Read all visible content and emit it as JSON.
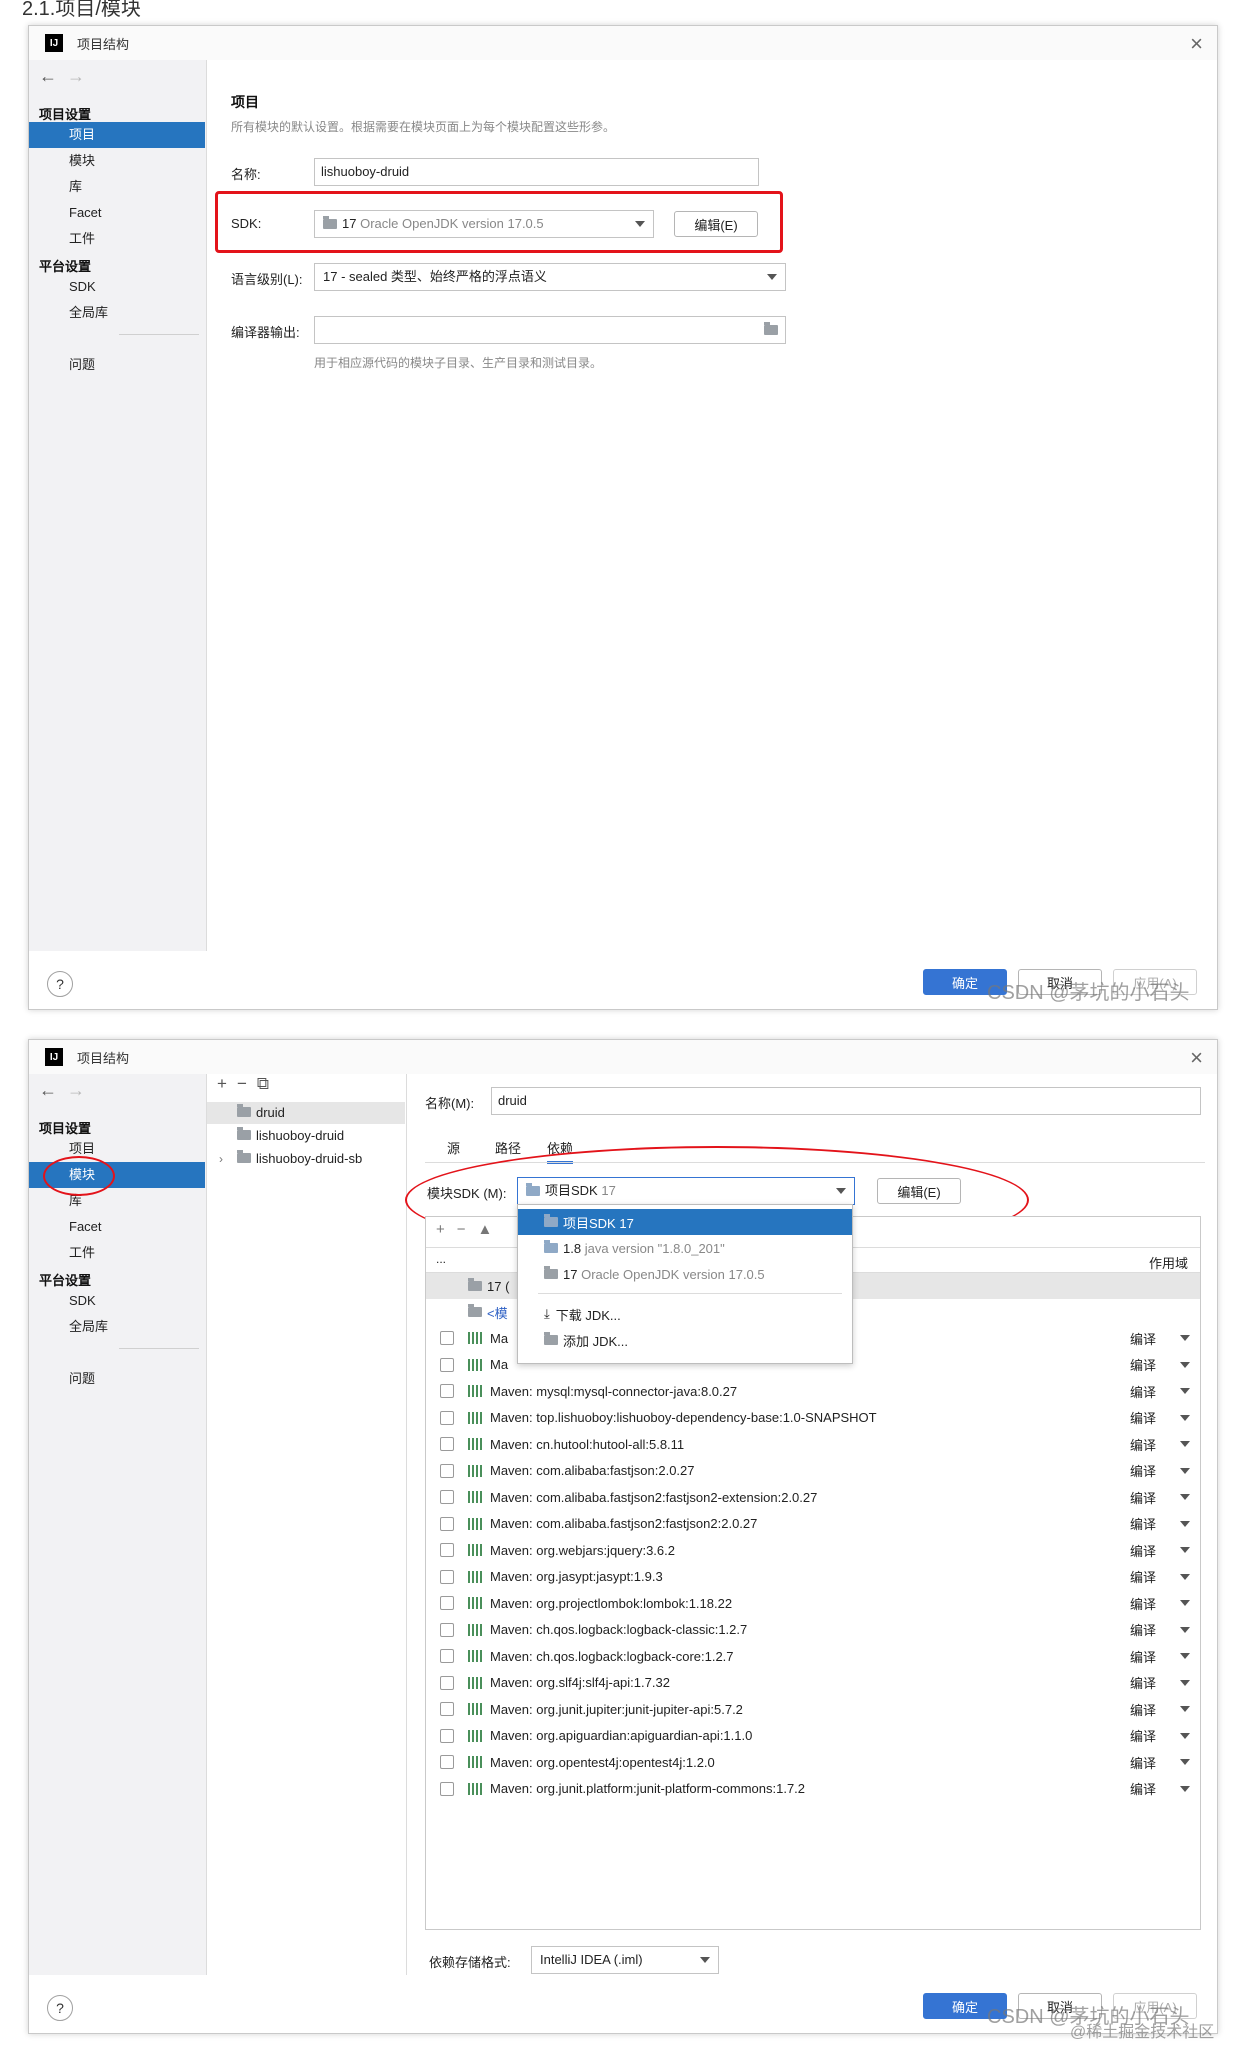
{
  "page_heading": "2.1.项目/模块",
  "watermark": "CSDN @茅坑的小石头",
  "site_watermark": "@稀土掘金技术社区",
  "dialog1": {
    "title": "项目结构",
    "sidebar": {
      "group_project": "项目设置",
      "items_project": [
        "项目",
        "模块",
        "库",
        "Facet",
        "工件"
      ],
      "group_platform": "平台设置",
      "items_platform": [
        "SDK",
        "全局库"
      ],
      "problems": "问题"
    },
    "section_title": "项目",
    "section_desc": "所有模块的默认设置。根据需要在模块页面上为每个模块配置这些形参。",
    "name_label": "名称:",
    "name_value": "lishuoboy-druid",
    "sdk_label": "SDK:",
    "sdk_value_num": "17",
    "sdk_value_desc": "Oracle OpenJDK version 17.0.5",
    "sdk_edit_button": "编辑(E)",
    "lang_label": "语言级别(L):",
    "lang_value": "17 - sealed 类型、始终严格的浮点语义",
    "compiler_label": "编译器输出:",
    "compiler_value": "",
    "compiler_hint": "用于相应源代码的模块子目录、生产目录和测试目录。",
    "ok_button": "确定",
    "cancel_button": "取消",
    "apply_button": "应用(A)",
    "help": "?"
  },
  "dialog2": {
    "title": "项目结构",
    "sidebar": {
      "group_project": "项目设置",
      "items_project": [
        "项目",
        "模块",
        "库",
        "Facet",
        "工件"
      ],
      "group_platform": "平台设置",
      "items_platform": [
        "SDK",
        "全局库"
      ],
      "problems": "问题"
    },
    "tree": [
      "druid",
      "lishuoboy-druid",
      "lishuoboy-druid-sb"
    ],
    "name_label": "名称(M):",
    "name_value": "druid",
    "tabs": [
      "源",
      "路径",
      "依赖"
    ],
    "module_sdk_label": "模块SDK (M):",
    "module_sdk_value": "项目SDK",
    "module_sdk_version": "17",
    "module_sdk_edit": "编辑(E)",
    "deps_header_col": "...",
    "deps_scope_header": "作用域",
    "dropdown": {
      "item1": "项目SDK 17",
      "item2_num": "1.8",
      "item2_desc": "java version \"1.8.0_201\"",
      "item3_num": "17",
      "item3_desc": "Oracle OpenJDK version 17.0.5",
      "download": "下载 JDK...",
      "add": "添加 JDK..."
    },
    "deps_sdk_row": "17 (",
    "deps_module_source_row": "<模",
    "dependencies": [
      "Ma",
      "Ma",
      "Maven: mysql:mysql-connector-java:8.0.27",
      "Maven: top.lishuoboy:lishuoboy-dependency-base:1.0-SNAPSHOT",
      "Maven: cn.hutool:hutool-all:5.8.11",
      "Maven: com.alibaba:fastjson:2.0.27",
      "Maven: com.alibaba.fastjson2:fastjson2-extension:2.0.27",
      "Maven: com.alibaba.fastjson2:fastjson2:2.0.27",
      "Maven: org.webjars:jquery:3.6.2",
      "Maven: org.jasypt:jasypt:1.9.3",
      "Maven: org.projectlombok:lombok:1.18.22",
      "Maven: ch.qos.logback:logback-classic:1.2.7",
      "Maven: ch.qos.logback:logback-core:1.2.7",
      "Maven: org.slf4j:slf4j-api:1.7.32",
      "Maven: org.junit.jupiter:junit-jupiter-api:5.7.2",
      "Maven: org.apiguardian:apiguardian-api:1.1.0",
      "Maven: org.opentest4j:opentest4j:1.2.0",
      "Maven: org.junit.platform:junit-platform-commons:1.7.2"
    ],
    "scope_value": "编译",
    "storage_label": "依赖存储格式:",
    "storage_value": "IntelliJ IDEA (.iml)",
    "ok_button": "确定",
    "cancel_button": "取消",
    "apply_button": "应用(A)",
    "help": "?"
  },
  "colors": {
    "selection": "#2675bf",
    "primary_button": "#3574d3",
    "annotation_red": "#e3131a"
  }
}
